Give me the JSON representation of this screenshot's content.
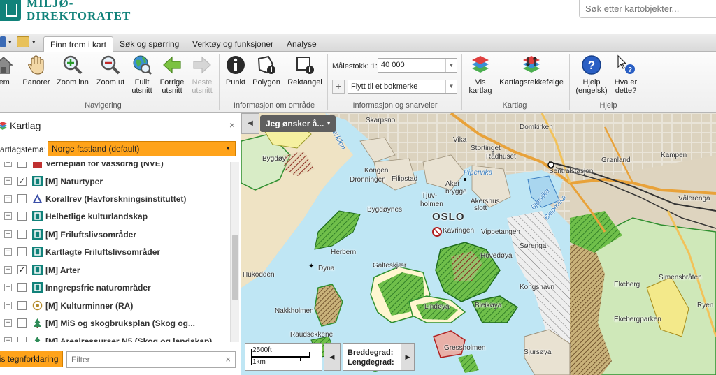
{
  "header": {
    "logo_line1": "MILJØ-",
    "logo_line2": "DIREKTORATET",
    "search_placeholder": "Søk etter kartobjekter..."
  },
  "tabs": [
    {
      "label": "Finn frem i kart",
      "active": true
    },
    {
      "label": "Søk og spørring",
      "active": false
    },
    {
      "label": "Verktøy og funksjoner",
      "active": false
    },
    {
      "label": "Analyse",
      "active": false
    }
  ],
  "ribbon": {
    "navigation": {
      "label": "Navigering",
      "buttons": [
        "Hjem",
        "Panorer",
        "Zoom inn",
        "Zoom ut",
        "Fullt utsnitt",
        "Forrige utsnitt",
        "Neste utsnitt"
      ],
      "home_visible": "jem",
      "full_line1": "Fullt",
      "full_line2": "utsnitt",
      "prev_line1": "Forrige",
      "prev_line2": "utsnitt",
      "next_line1": "Neste",
      "next_line2": "utsnitt"
    },
    "info_area": {
      "label": "Informasjon om område",
      "buttons": [
        "Punkt",
        "Polygon",
        "Rektangel"
      ]
    },
    "info_shortcuts": {
      "label": "Informasjon og snarveier",
      "scale_label": "Målestokk: 1:",
      "scale_value": "40 000",
      "bookmark_placeholder": "Flytt til et bokmerke"
    },
    "layers": {
      "label": "Kartlag",
      "show_line1": "Vis",
      "show_line2": "kartlag",
      "order": "Kartlagsrekkefølge"
    },
    "help": {
      "label": "Hjelp",
      "help_line1": "Hjelp",
      "help_line2": "(engelsk)",
      "what_line1": "Hva er",
      "what_line2": "dette?"
    }
  },
  "panel": {
    "title": "Kartlag",
    "theme_label": "Kartlagstema:",
    "theme_value": "Norge fastland (default)",
    "layers": [
      {
        "name": "Verneplan for vassdrag (NVE)",
        "checked": false,
        "icon": "nve-icon"
      },
      {
        "name": "[M] Naturtyper",
        "checked": true,
        "icon": "miljodir-icon"
      },
      {
        "name": "Korallrev (Havforskningsinstituttet)",
        "checked": false,
        "icon": "coral-icon"
      },
      {
        "name": "Helhetlige kulturlandskap",
        "checked": false,
        "icon": "miljodir-icon"
      },
      {
        "name": "[M] Friluftslivsområder",
        "checked": false,
        "icon": "miljodir-icon"
      },
      {
        "name": "Kartlagte Friluftslivsområder",
        "checked": false,
        "icon": "miljodir-icon"
      },
      {
        "name": "[M] Arter",
        "checked": true,
        "icon": "miljodir-icon"
      },
      {
        "name": "Inngrepsfrie naturområder",
        "checked": false,
        "icon": "miljodir-icon"
      },
      {
        "name": "[M] Kulturminner (RA)",
        "checked": false,
        "icon": "ra-icon"
      },
      {
        "name": "[M] MiS og skogbruksplan (Skog og...",
        "checked": false,
        "icon": "tree-icon"
      },
      {
        "name": "[M] Arealressurser N5 (Skog og landskap)",
        "checked": false,
        "icon": "tree-icon"
      }
    ],
    "legend_button": "Vis tegnforklaring",
    "filter_placeholder": "Filter"
  },
  "map": {
    "want_button": "Jeg ønsker å...",
    "scale_ft": "2500ft",
    "scale_km": "1km",
    "lat_label": "Breddegrad:",
    "lon_label": "Lengdegrad:",
    "labels": [
      {
        "text": "OSLO"
      },
      {
        "text": "Vika"
      },
      {
        "text": "Stortinget"
      },
      {
        "text": "Rådhuset"
      },
      {
        "text": "Domkirken"
      },
      {
        "text": "Grønland"
      },
      {
        "text": "Kampen"
      },
      {
        "text": "Sentralstasjon"
      },
      {
        "text": "Kongen"
      },
      {
        "text": "Dronningen"
      },
      {
        "text": "Filipstad"
      },
      {
        "text": "Tjuv-"
      },
      {
        "text": "holmen"
      },
      {
        "text": "Aker"
      },
      {
        "text": "brygge"
      },
      {
        "text": "Akershus"
      },
      {
        "text": "slott"
      },
      {
        "text": "Bygdøynes"
      },
      {
        "text": "Kavringen"
      },
      {
        "text": "Vippetangen"
      },
      {
        "text": "Herbern"
      },
      {
        "text": "Dyna"
      },
      {
        "text": "Hukodden"
      },
      {
        "text": "Galteskjær"
      },
      {
        "text": "Hovedøya"
      },
      {
        "text": "Nakkholmen"
      },
      {
        "text": "Lindøya"
      },
      {
        "text": "Bleikøya"
      },
      {
        "text": "Raudsekkene"
      },
      {
        "text": "Gressholmen"
      },
      {
        "text": "Sjursøya"
      },
      {
        "text": "Kongshavn"
      },
      {
        "text": "Sørenga"
      },
      {
        "text": "Ekeberg"
      },
      {
        "text": "Simensbråten"
      },
      {
        "text": "Ekebergparken"
      },
      {
        "text": "Vålerenga"
      },
      {
        "text": "Frognerkilen"
      },
      {
        "text": "Bjørvika"
      },
      {
        "text": "Bispevika"
      },
      {
        "text": "Pipervika"
      },
      {
        "text": "Skarpsno"
      },
      {
        "text": "Bygdøy"
      },
      {
        "text": "Ryen"
      }
    ]
  },
  "colors": {
    "brand": "#11827a",
    "accent_orange": "#ffa31a",
    "water": "#bfe6f4",
    "land": "#e6e0d2",
    "forest": "#2f8f2f",
    "hatch_red": "#9b2b2b"
  }
}
